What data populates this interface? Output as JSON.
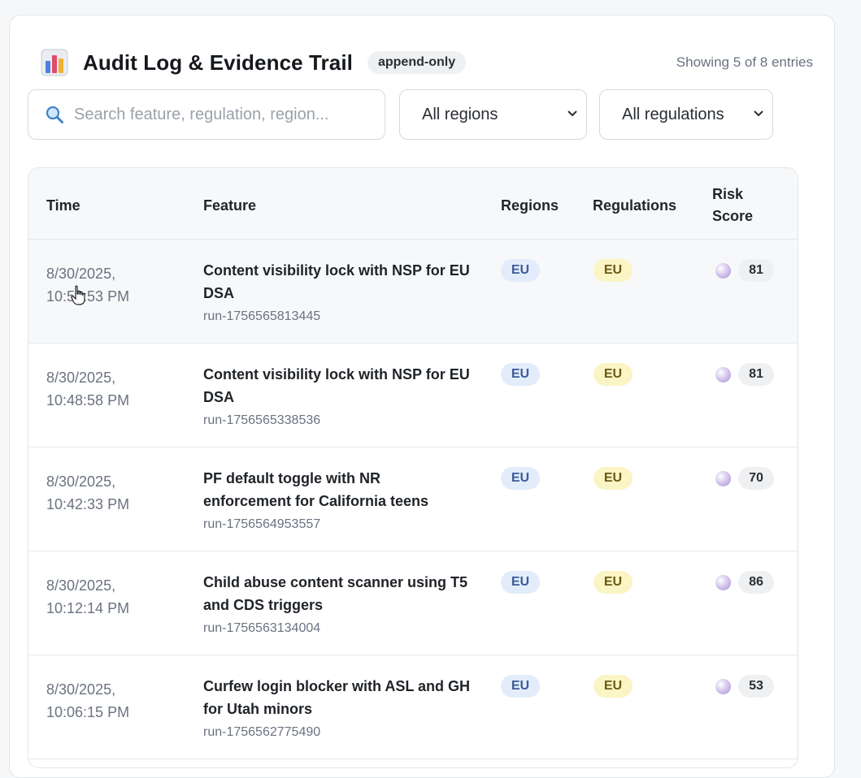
{
  "header": {
    "title": "Audit Log & Evidence Trail",
    "badge": "append-only",
    "count": "Showing 5 of 8 entries",
    "icon": "bar-chart-icon"
  },
  "filters": {
    "search_placeholder": "Search feature, regulation, region...",
    "search_icon": "magnifier-icon",
    "region_select": "All regions",
    "regulation_select": "All regulations"
  },
  "table": {
    "columns": [
      "Time",
      "Feature",
      "Regions",
      "Regulations",
      "Risk",
      "Score"
    ],
    "rows": [
      {
        "date": "8/30/2025,",
        "time": "10:56:53 PM",
        "feature": "Content visibility lock with NSP for EU DSA",
        "run": "run-1756565813445",
        "region": "EU",
        "regulation": "EU",
        "score": "81"
      },
      {
        "date": "8/30/2025,",
        "time": "10:48:58 PM",
        "feature": "Content visibility lock with NSP for EU DSA",
        "run": "run-1756565338536",
        "region": "EU",
        "regulation": "EU",
        "score": "81"
      },
      {
        "date": "8/30/2025,",
        "time": "10:42:33 PM",
        "feature": "PF default toggle with NR enforcement for California teens",
        "run": "run-1756564953557",
        "region": "EU",
        "regulation": "EU",
        "score": "70"
      },
      {
        "date": "8/30/2025,",
        "time": "10:12:14 PM",
        "feature": "Child abuse content scanner using T5 and CDS triggers",
        "run": "run-1756563134004",
        "region": "EU",
        "regulation": "EU",
        "score": "86"
      },
      {
        "date": "8/30/2025,",
        "time": "10:06:15 PM",
        "feature": "Curfew login blocker with ASL and GH for Utah minors",
        "run": "run-1756562775490",
        "region": "EU",
        "regulation": "EU",
        "score": "53"
      }
    ]
  },
  "colors": {
    "region_chip_bg": "#e3ecfb",
    "regulation_chip_bg": "#fbf4c4",
    "score_chip_bg": "#eef0f2",
    "risk_dot": "#b9a6dc"
  }
}
